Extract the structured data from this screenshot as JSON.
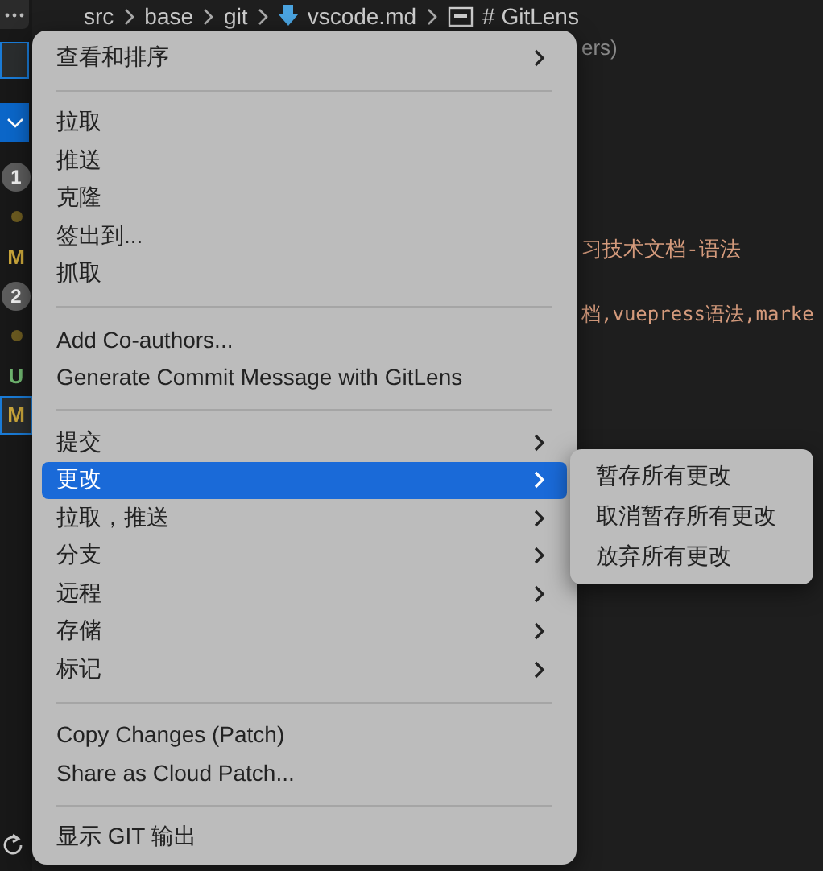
{
  "breadcrumb": {
    "segments": [
      {
        "label": "src",
        "kind": "folder"
      },
      {
        "label": "base",
        "kind": "folder"
      },
      {
        "label": "git",
        "kind": "folder"
      },
      {
        "label": "vscode.md",
        "kind": "file"
      },
      {
        "label": "# GitLens",
        "kind": "symbol"
      }
    ]
  },
  "side_strip": {
    "badges": [
      {
        "label": "1",
        "kind": "count",
        "selected": false
      },
      {
        "kind": "dot",
        "selected": false
      },
      {
        "label": "M",
        "kind": "letter",
        "color": "#c9a53a",
        "selected": false
      },
      {
        "label": "2",
        "kind": "count",
        "selected": false
      },
      {
        "kind": "dot",
        "selected": false
      },
      {
        "label": "U",
        "kind": "letter",
        "color": "#6fb46f",
        "selected": false
      },
      {
        "label": "M",
        "kind": "letter",
        "color": "#c9a53a",
        "selected": true
      }
    ]
  },
  "editor": {
    "lines": [
      "ers)",
      "习技术文档-语法",
      "档,vuepress语法,marke"
    ]
  },
  "context_menu": {
    "groups": [
      [
        {
          "label": "查看和排序",
          "submenu": true,
          "selected": false
        }
      ],
      [
        {
          "label": "拉取",
          "submenu": false,
          "selected": false
        },
        {
          "label": "推送",
          "submenu": false,
          "selected": false
        },
        {
          "label": "克隆",
          "submenu": false,
          "selected": false
        },
        {
          "label": "签出到...",
          "submenu": false,
          "selected": false
        },
        {
          "label": "抓取",
          "submenu": false,
          "selected": false
        }
      ],
      [
        {
          "label": "Add Co-authors...",
          "submenu": false,
          "selected": false
        },
        {
          "label": "Generate Commit Message with GitLens",
          "submenu": false,
          "selected": false
        }
      ],
      [
        {
          "label": "提交",
          "submenu": true,
          "selected": false
        },
        {
          "label": "更改",
          "submenu": true,
          "selected": true
        },
        {
          "label": "拉取，推送",
          "submenu": true,
          "selected": false
        },
        {
          "label": "分支",
          "submenu": true,
          "selected": false
        },
        {
          "label": "远程",
          "submenu": true,
          "selected": false
        },
        {
          "label": "存储",
          "submenu": true,
          "selected": false
        },
        {
          "label": "标记",
          "submenu": true,
          "selected": false
        }
      ],
      [
        {
          "label": "Copy Changes (Patch)",
          "submenu": false,
          "selected": false
        },
        {
          "label": "Share as Cloud Patch...",
          "submenu": false,
          "selected": false
        }
      ],
      [
        {
          "label": "显示 GIT 输出",
          "submenu": false,
          "selected": false
        }
      ]
    ]
  },
  "submenu": {
    "items": [
      {
        "label": "暂存所有更改"
      },
      {
        "label": "取消暂存所有更改"
      },
      {
        "label": "放弃所有更改"
      }
    ]
  }
}
